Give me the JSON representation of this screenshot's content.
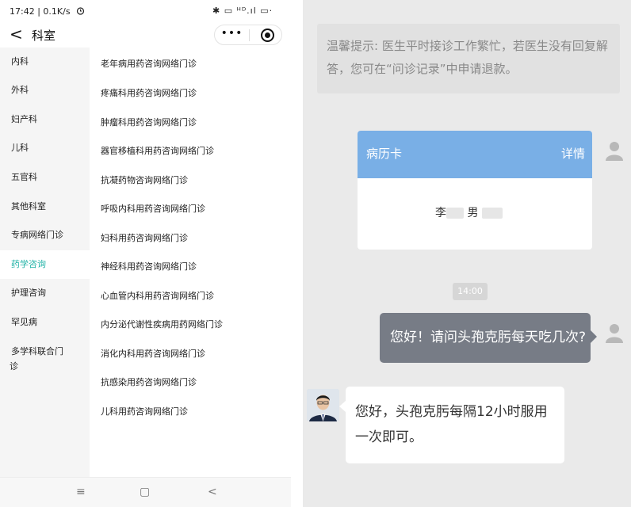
{
  "left_screen": {
    "status_bar": {
      "time_speed": "17:42 | 0.1K/s",
      "system_icons": "✱ ▭ ᴴᴰ.ıl ▭·"
    },
    "nav": {
      "back_glyph": "<",
      "title": "科室",
      "capsule_more": "•••"
    },
    "departments": [
      "内科",
      "外科",
      "妇产科",
      "儿科",
      "五官科",
      "其他科室",
      "专病网络门诊",
      "药学咨询",
      "护理咨询",
      "罕见病",
      "多学科联合门",
      "诊"
    ],
    "active_department": "药学咨询",
    "clinics": [
      "老年病用药咨询网络门诊",
      "疼痛科用药咨询网络门诊",
      "肿瘤科用药咨询网络门诊",
      "器官移植科用药咨询网络门诊",
      "抗凝药物咨询网络门诊",
      "呼吸内科用药咨询网络门诊",
      "妇科用药咨询网络门诊",
      "神经科用药咨询网络门诊",
      "心血管内科用药咨询网络门诊",
      "内分泌代谢性疾病用药网络门诊",
      "消化内科用药咨询网络门诊",
      "抗感染用药咨询网络门诊",
      "儿科用药咨询网络门诊"
    ],
    "bottom_nav": {
      "menu": "≡",
      "home": "▢",
      "back": "<"
    }
  },
  "right_screen": {
    "notice": "温馨提示: 医生平时接诊工作繁忙，若医生没有回复解答，您可在“问诊记录”中申请退款。",
    "record_card": {
      "title": "病历卡",
      "detail": "详情",
      "patient_name_initial": "李",
      "patient_gender": "男"
    },
    "timestamp": "14:00",
    "messages": [
      {
        "from": "patient",
        "text": "您好！请问头孢克肟每天吃几次?"
      },
      {
        "from": "doctor",
        "text": "您好，头孢克肟每隔12小时服用一次即可。"
      }
    ],
    "colors": {
      "accent_teal": "#23b3a7",
      "card_header_blue": "#79afe6",
      "patient_bubble": "#777c86"
    }
  }
}
